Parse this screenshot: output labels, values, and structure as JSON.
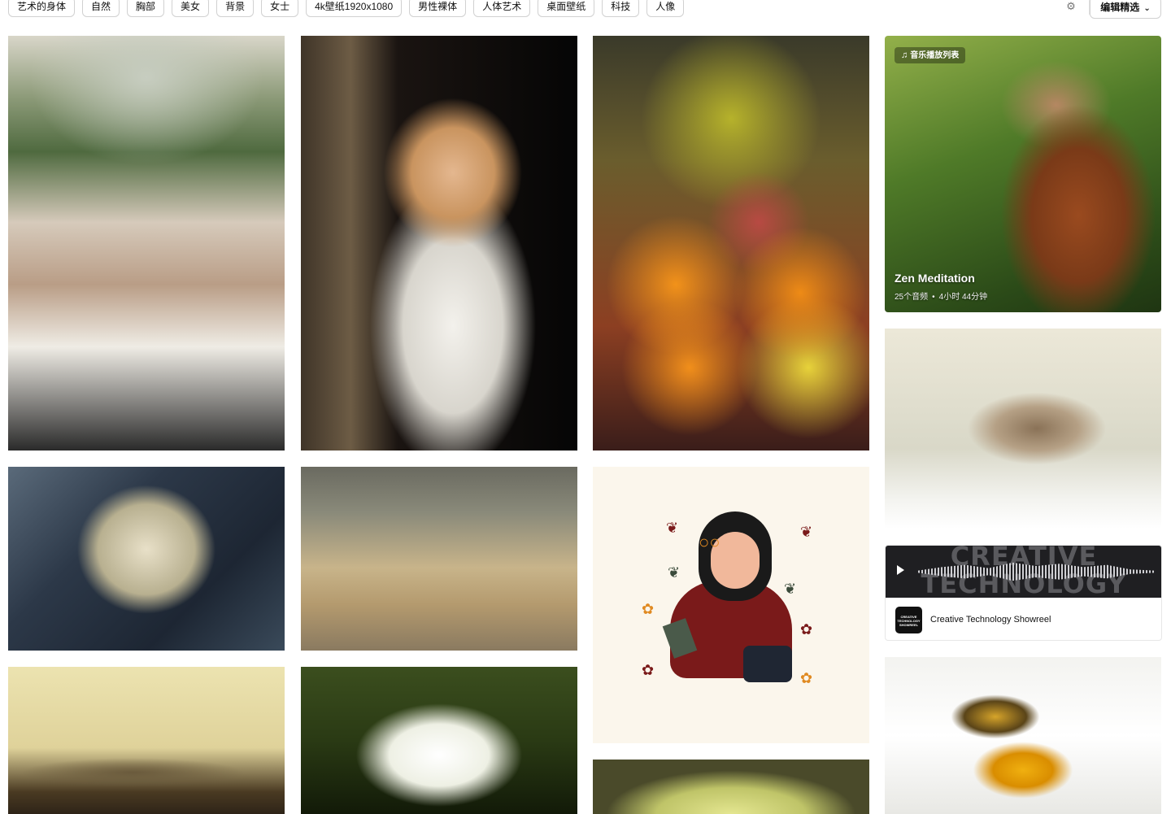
{
  "tags": [
    "艺术的身体",
    "自然",
    "胸部",
    "美女",
    "背景",
    "女士",
    "4k壁纸1920x1080",
    "男性裸体",
    "人体艺术",
    "桌面壁纸",
    "科技",
    "人像"
  ],
  "toolbar": {
    "settings_icon": "gear-icon",
    "filter_label": "编辑精选",
    "filter_icon": "chevron-down-icon"
  },
  "playlist": {
    "badge": "音乐播放列表",
    "badge_icon": "music-note-icon",
    "title": "Zen Meditation",
    "count": "25个音频",
    "separator": "•",
    "duration": "4小时 44分钟"
  },
  "video": {
    "thumb_text_line1": "CREATIVE",
    "thumb_text_line2": "TECHNOLOGY",
    "logo_text": "CREATIVE TECHNOLOGY SHOWREEL",
    "title": "Creative Technology Showreel",
    "play_icon": "play-icon"
  },
  "photos": [
    "dinner-party-wine-photo",
    "blonde-woman-portrait-photo",
    "fruit-market-photo",
    "meditating-monk-photo",
    "white-snake-on-branch-photo",
    "misty-lake-boat-photo",
    "girl-with-book-illustration",
    "sparrow-photo",
    "lizard-photo",
    "white-lily-photo",
    "bee-on-flower-photo",
    "green-apple-photo"
  ]
}
